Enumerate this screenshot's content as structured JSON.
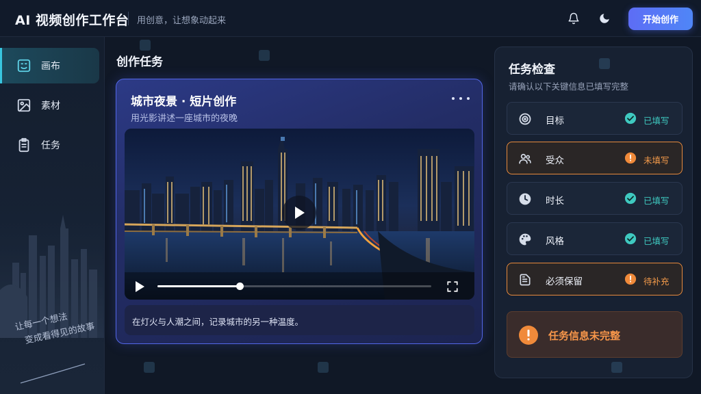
{
  "header": {
    "title": "AI 视频创作工作台",
    "tagline": "用创意，让想象动起来",
    "start_button": "开始创作",
    "icons": [
      "bell-icon",
      "moon-icon"
    ]
  },
  "sidebar": {
    "items": [
      {
        "label": "画布",
        "icon": "canvas-icon",
        "active": true
      },
      {
        "label": "素材",
        "icon": "image-icon",
        "active": false
      },
      {
        "label": "任务",
        "icon": "clipboard-icon",
        "active": false
      }
    ],
    "slogan_line1": "让每一个想法",
    "slogan_line2": "变成看得见的故事"
  },
  "main": {
    "section_title": "创作任务",
    "card": {
      "title": "城市夜景 · 短片创作",
      "subtitle": "用光影讲述一座城市的夜晚",
      "video_progress": 0.3,
      "description": "在灯火与人潮之间，记录城市的另一种温度。"
    }
  },
  "checklist": {
    "title": "任务检查",
    "subtitle": "请确认以下关键信息已填写完整",
    "rows": [
      {
        "label": "目标",
        "icon": "target-icon",
        "status": "已填写",
        "state": "ok"
      },
      {
        "label": "受众",
        "icon": "users-icon",
        "status": "未填写",
        "state": "warn"
      },
      {
        "label": "时长",
        "icon": "clock-icon",
        "status": "已填写",
        "state": "ok"
      },
      {
        "label": "风格",
        "icon": "palette-icon",
        "status": "已填写",
        "state": "ok"
      },
      {
        "label": "必须保留",
        "icon": "document-icon",
        "status": "待补充",
        "state": "warn"
      }
    ],
    "alert": "任务信息未完整"
  },
  "colors": {
    "accent": "#5d6df5",
    "ok": "#3fc9c0",
    "warn": "#f29a4a",
    "active_nav": "#38c6e0"
  }
}
